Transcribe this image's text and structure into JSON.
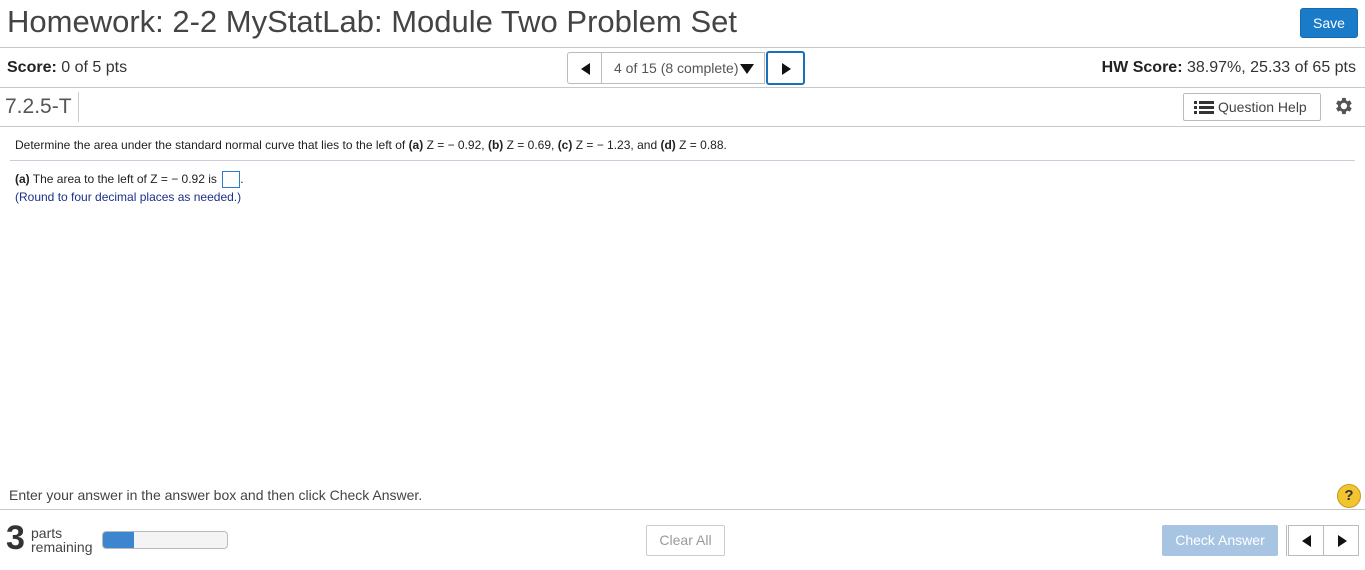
{
  "header": {
    "title": "Homework: 2-2 MyStatLab: Module Two Problem Set",
    "save_label": "Save"
  },
  "score": {
    "label": "Score:",
    "value": "0 of 5 pts",
    "hw_label": "HW Score:",
    "hw_value": "38.97%, 25.33 of 65 pts"
  },
  "navigation": {
    "position_text": "4 of 15 (8 complete)",
    "prev_icon": "triangle-left",
    "next_icon": "triangle-right",
    "dropdown_icon": "triangle-down"
  },
  "question_bar": {
    "id": "7.2.5-T",
    "help_label": "Question Help",
    "help_icon": "list-icon",
    "settings_icon": "gear-icon"
  },
  "question": {
    "prefix": "Determine the area under the standard normal curve that lies to the left of ",
    "a_label": "(a)",
    "a_expr": "Z = − 0.92,",
    "b_label": "(b)",
    "b_expr": "Z = 0.69,",
    "c_label": "(c)",
    "c_expr": "Z = − 1.23,",
    "and_text": "and",
    "d_label": "(d)",
    "d_expr": "Z = 0.88."
  },
  "part_a": {
    "label": "(a)",
    "text": "The area to the left of Z = − 0.92 is",
    "answer_value": "",
    "period": ".",
    "note": "(Round to four decimal places as needed.)"
  },
  "instruction": "Enter your answer in the answer box and then click Check Answer.",
  "help_symbol": "?",
  "footer": {
    "parts_count": "3",
    "parts_line1": "parts",
    "parts_line2": "remaining",
    "progress_fraction": 0.25,
    "clear_label": "Clear All",
    "check_label": "Check Answer"
  },
  "colors": {
    "primary": "#1a7bc9",
    "progress": "#3d86cf",
    "check_disabled": "#a7c5e2",
    "note_text": "#1a2f8a",
    "help_badge": "#f3c432"
  }
}
